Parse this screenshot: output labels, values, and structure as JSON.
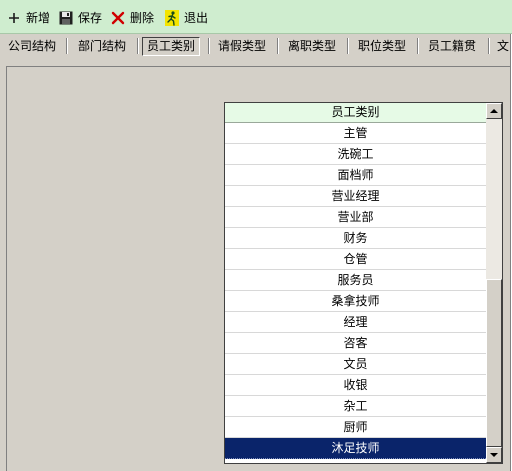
{
  "toolbar": {
    "add_label": "新增",
    "save_label": "保存",
    "delete_label": "删除",
    "exit_label": "退出"
  },
  "tabs": [
    {
      "label": "公司结构",
      "active": false
    },
    {
      "label": "部门结构",
      "active": false
    },
    {
      "label": "员工类别",
      "active": true
    },
    {
      "label": "请假类型",
      "active": false
    },
    {
      "label": "离职类型",
      "active": false
    },
    {
      "label": "职位类型",
      "active": false
    },
    {
      "label": "员工籍贯",
      "active": false
    },
    {
      "label": "文",
      "active": false
    }
  ],
  "grid": {
    "header": "员工类别",
    "rows": [
      "主管",
      "洗碗工",
      "面档师",
      "营业经理",
      "营业部",
      "财务",
      "仓管",
      "服务员",
      "桑拿技师",
      "经理",
      "咨客",
      "文员",
      "收银",
      "杂工",
      "厨师",
      "沐足技师"
    ],
    "selected_index": 15
  },
  "colors": {
    "toolbar_bg": "#cfedcf",
    "header_bg": "#e6fae6",
    "selection": "#0a246a",
    "window_bg": "#d4d0c8"
  },
  "icons": {
    "add": "plus-icon",
    "save": "floppy-disk-icon",
    "delete": "red-x-icon",
    "exit": "running-man-icon"
  }
}
